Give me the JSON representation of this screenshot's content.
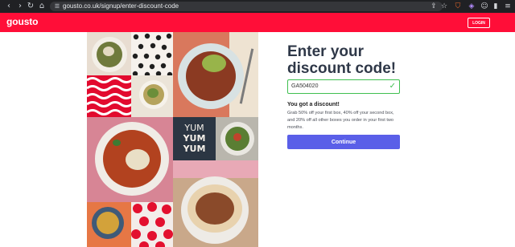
{
  "browser": {
    "url": "gousto.co.uk/signup/enter-discount-code",
    "icons": [
      "back-icon",
      "forward-icon",
      "reload-icon",
      "home-icon",
      "site-info-icon",
      "share-icon",
      "bookmark-icon",
      "brave-shield-icon",
      "extension-icon",
      "profile-icon",
      "sidebar-icon",
      "menu-icon"
    ]
  },
  "header": {
    "logo": "gousto",
    "login_label": "LOGIN",
    "brand_color": "#ff0e38"
  },
  "collage": {
    "text_lines": [
      "YUM",
      "YUM",
      "YUM"
    ]
  },
  "form": {
    "title_line1": "Enter your",
    "title_line2": "discount code!",
    "code_value": "GA504020",
    "success_title": "You got a discount!",
    "success_desc": "Grab 50% off your first box, 40% off your second box, and 20% off all other boxes you order in your first two months.",
    "continue_label": "Continue",
    "success_color": "#3fbf50",
    "button_color": "#5a5fe8"
  }
}
